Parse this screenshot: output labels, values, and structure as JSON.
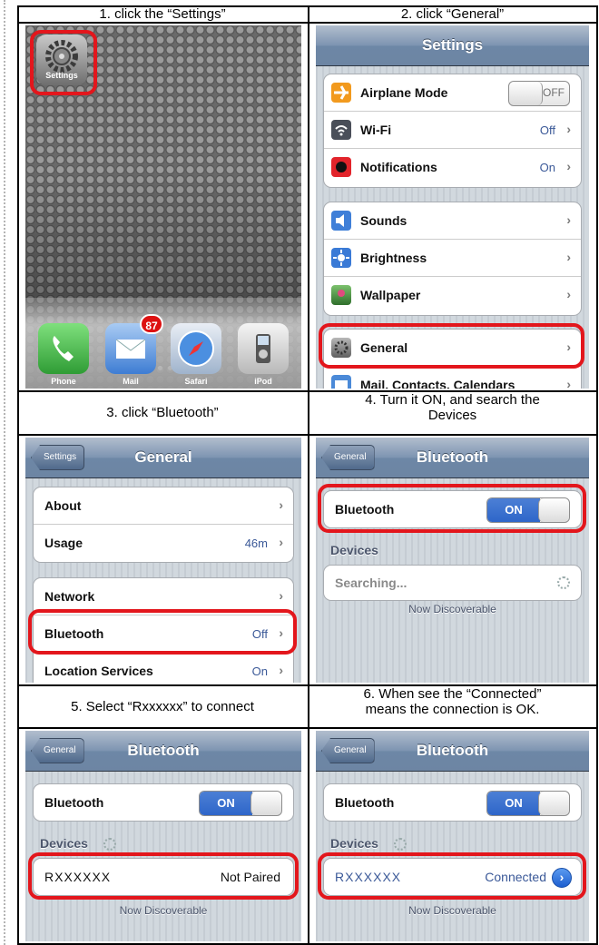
{
  "captions": {
    "step1": "1. click the “Settings”",
    "step2": "2. click “General”",
    "step3": "3.  click “Bluetooth”",
    "step4_line1": "4.  Turn it ON, and search the",
    "step4_line2": "Devices",
    "step5": "5. Select “Rxxxxxx” to connect",
    "step6_line1": "6. When see the “Connected”",
    "step6_line2": "means the connection is OK."
  },
  "home": {
    "settings_label": "Settings",
    "dock": [
      {
        "label": "Phone",
        "icon": "phone-icon",
        "color": "#47c34a"
      },
      {
        "label": "Mail",
        "icon": "mail-icon",
        "color": "#4b88d8",
        "badge": "87"
      },
      {
        "label": "Safari",
        "icon": "safari-icon",
        "color": "#3c8ad8"
      },
      {
        "label": "iPod",
        "icon": "ipod-icon",
        "color": "#d9d9d9"
      }
    ]
  },
  "settings": {
    "title": "Settings",
    "airplane": "Airplane Mode",
    "airplane_val": "OFF",
    "wifi": "Wi-Fi",
    "wifi_val": "Off",
    "notifications": "Notifications",
    "notifications_val": "On",
    "sounds": "Sounds",
    "brightness": "Brightness",
    "wallpaper": "Wallpaper",
    "general": "General",
    "mail": "Mail, Contacts, Calendars"
  },
  "general": {
    "back": "Settings",
    "title": "General",
    "about": "About",
    "usage": "Usage",
    "usage_val": "46m",
    "network": "Network",
    "bluetooth": "Bluetooth",
    "bluetooth_val": "Off",
    "location": "Location Services",
    "location_val": "On"
  },
  "bt_search": {
    "back": "General",
    "title": "Bluetooth",
    "row": "Bluetooth",
    "switch": "ON",
    "devices": "Devices",
    "searching": "Searching...",
    "note": "Now Discoverable"
  },
  "bt_select": {
    "back": "General",
    "title": "Bluetooth",
    "row": "Bluetooth",
    "switch": "ON",
    "devices": "Devices",
    "device": "RXXXXXX",
    "status": "Not Paired",
    "note": "Now Discoverable"
  },
  "bt_connected": {
    "back": "General",
    "title": "Bluetooth",
    "row": "Bluetooth",
    "switch": "ON",
    "devices": "Devices",
    "device": "RXXXXXX",
    "status": "Connected",
    "note": "Now Discoverable"
  },
  "colors": {
    "highlight": "#e3161c",
    "nav": "#6d87a6",
    "link_blue": "#3b5998"
  }
}
